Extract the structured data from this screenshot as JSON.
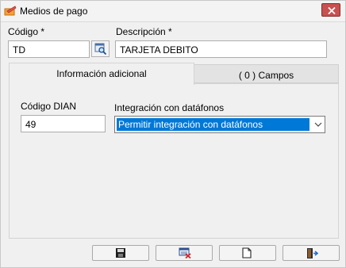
{
  "window": {
    "title": "Medios de pago",
    "icons": {
      "app": "payment-app-icon",
      "close": "close-icon"
    }
  },
  "form": {
    "codigo_label": "Código *",
    "codigo_value": "TD",
    "descripcion_label": "Descripción *",
    "descripcion_value": "TARJETA DEBITO",
    "lookup_icon": "magnifier-icon"
  },
  "tabs": [
    {
      "label": "Información adicional",
      "active": true
    },
    {
      "label": "( 0 ) Campos",
      "active": false
    }
  ],
  "info_tab": {
    "codigo_dian_label": "Código DIAN",
    "codigo_dian_value": "49",
    "integracion_label": "Integración con datáfonos",
    "integracion_selected": "Permitir integración con datáfonos"
  },
  "toolbar": {
    "buttons": [
      {
        "name": "save",
        "icon": "floppy-disk-icon"
      },
      {
        "name": "delete",
        "icon": "delete-record-icon"
      },
      {
        "name": "new",
        "icon": "new-document-icon"
      },
      {
        "name": "exit",
        "icon": "exit-door-icon"
      }
    ]
  },
  "colors": {
    "selection": "#0078d7",
    "close": "#c75050"
  }
}
